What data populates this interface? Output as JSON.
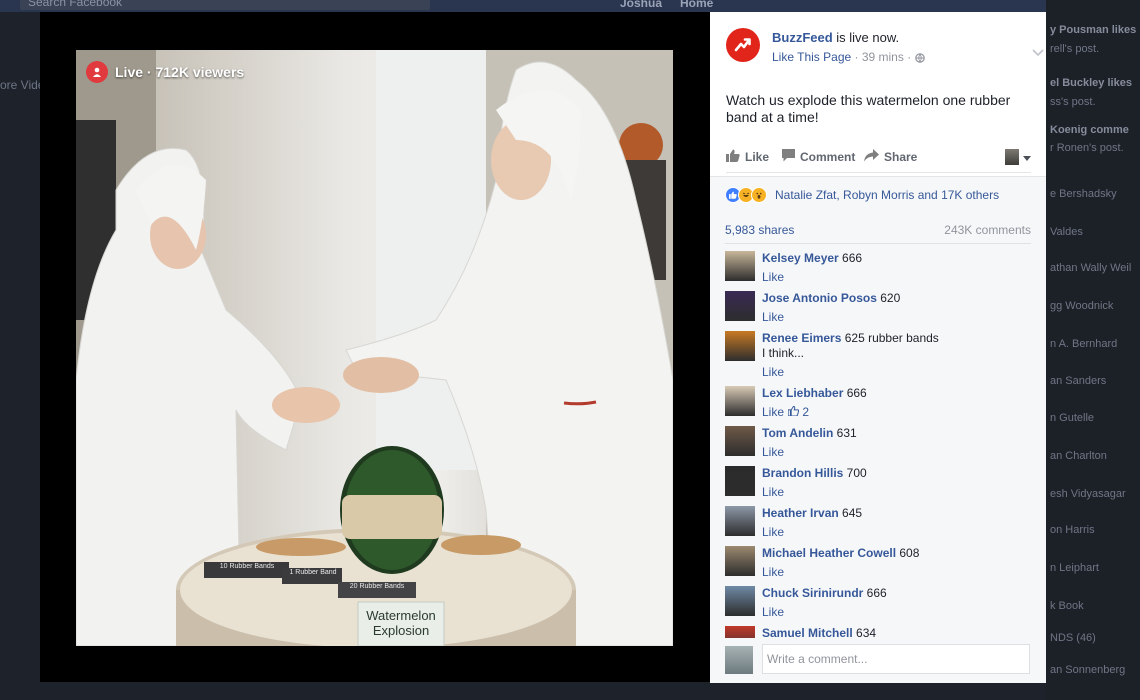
{
  "colors": {
    "fb_blue": "#365899",
    "live_red": "#e03a3e",
    "buzzfeed_red": "#e1251b",
    "secondary": "#90949c"
  },
  "background_page": {
    "search_placeholder": "Search Facebook",
    "top_name": "Joshua",
    "top_home": "Home",
    "left_label": "ore Vide",
    "right_items": [
      {
        "text": "y Pousman likes",
        "bold": true
      },
      {
        "text": "rell's post.",
        "bold": false
      },
      {
        "text": "el Buckley likes",
        "bold": true
      },
      {
        "text": "ss's post.",
        "bold": false
      },
      {
        "text": "Koenig comme",
        "bold": true
      },
      {
        "text": "r Ronen's post.",
        "bold": false
      },
      {
        "text": "e Bershadsky",
        "bold": false
      },
      {
        "text": "Valdes",
        "bold": false
      },
      {
        "text": "athan Wally Weil",
        "bold": false
      },
      {
        "text": "gg Woodnick",
        "bold": false
      },
      {
        "text": "n A. Bernhard",
        "bold": false
      },
      {
        "text": "an Sanders",
        "bold": false
      },
      {
        "text": "n Gutelle",
        "bold": false
      },
      {
        "text": "an Charlton",
        "bold": false
      },
      {
        "text": "esh Vidyasagar",
        "bold": false
      },
      {
        "text": "on Harris",
        "bold": false
      },
      {
        "text": "n Leiphart",
        "bold": false
      },
      {
        "text": "k Book",
        "bold": false
      },
      {
        "text": "NDS (46)",
        "bold": false
      },
      {
        "text": "an Sonnenberg",
        "bold": false
      }
    ]
  },
  "video": {
    "live_label": "Live",
    "viewers": " · 712K viewers",
    "table_sign_line1": "Watermelon",
    "table_sign_line2": "Explosion",
    "placard1": "10 Rubber Bands",
    "placard2": "1 Rubber Band",
    "placard3": "20 Rubber Bands"
  },
  "post": {
    "page_name": "BuzzFeed",
    "is_live_text": " is live now.",
    "like_page": "Like This Page",
    "time": " · 39 mins · ",
    "globe_icon": "globe-icon",
    "body": "Watch us explode this watermelon one rubber band at a time!",
    "actions": {
      "like": "Like",
      "comment": "Comment",
      "share": "Share"
    },
    "reactions": {
      "icons": [
        "like-icon",
        "haha-icon",
        "wow-icon"
      ],
      "text": "Natalie Zfat, Robyn Morris and 17K others"
    },
    "shares": "5,983 shares",
    "comments_count": "243K comments",
    "comment_placeholder": "Write a comment..."
  },
  "comments": [
    {
      "name": "Kelsey Meyer",
      "text": " 666",
      "text2": "",
      "like": "Like",
      "reacts": "",
      "avatar": "#c8b79a"
    },
    {
      "name": "Jose Antonio Posos",
      "text": " 620",
      "text2": "",
      "like": "Like",
      "reacts": "",
      "avatar": "#3a2a55"
    },
    {
      "name": "Renee Eimers",
      "text": " 625 rubber bands",
      "text2": "I think...",
      "like": "Like",
      "reacts": "",
      "avatar": "#c97a24"
    },
    {
      "name": "Lex Liebhaber",
      "text": " 666",
      "text2": "",
      "like": "Like",
      "reacts": "2",
      "avatar": "#d9cbb6"
    },
    {
      "name": "Tom Andelin",
      "text": " 631",
      "text2": "",
      "like": "Like",
      "reacts": "",
      "avatar": "#6f5a48"
    },
    {
      "name": "Brandon Hillis",
      "text": " 700",
      "text2": "",
      "like": "Like",
      "reacts": "",
      "avatar": "#2b2b2b"
    },
    {
      "name": "Heather Irvan",
      "text": " 645",
      "text2": "",
      "like": "Like",
      "reacts": "",
      "avatar": "#8d98a8"
    },
    {
      "name": "Michael Heather Cowell",
      "text": " 608",
      "text2": "",
      "like": "Like",
      "reacts": "",
      "avatar": "#9c8a6f"
    },
    {
      "name": "Chuck Sirinirundr",
      "text": " 666",
      "text2": "",
      "like": "Like",
      "reacts": "",
      "avatar": "#6f8aa6"
    },
    {
      "name": "Samuel Mitchell",
      "text": " 634",
      "text2": "",
      "like": "Like",
      "reacts": "",
      "avatar": "#c0392b"
    }
  ]
}
